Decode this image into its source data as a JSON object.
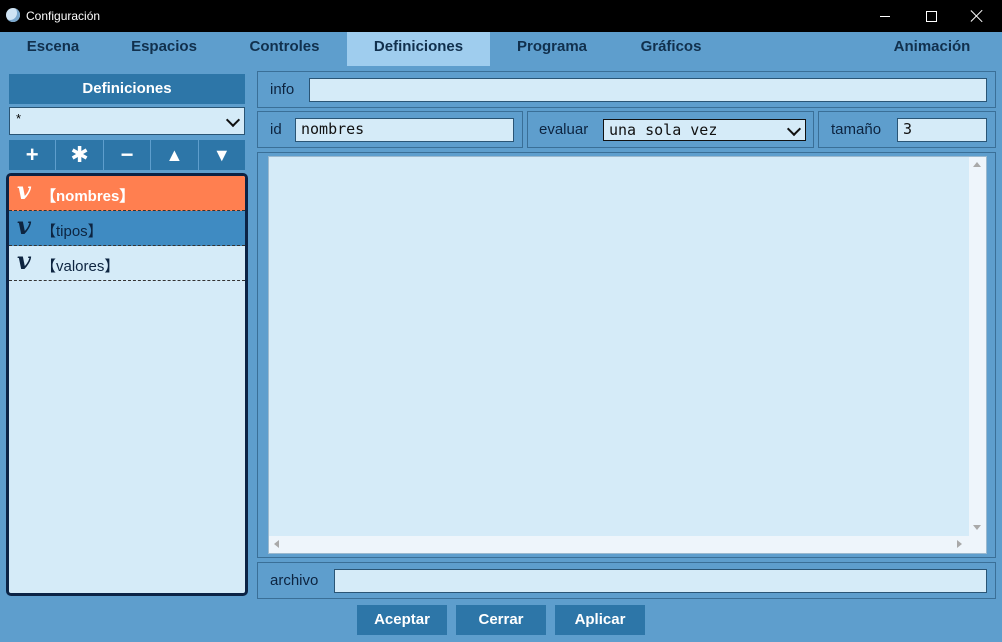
{
  "window": {
    "title": "Configuración"
  },
  "tabs": [
    {
      "label": "Escena"
    },
    {
      "label": "Espacios"
    },
    {
      "label": "Controles"
    },
    {
      "label": "Definiciones",
      "active": true
    },
    {
      "label": "Programa"
    },
    {
      "label": "Gráficos"
    },
    {
      "label": "Animación"
    }
  ],
  "sidebar": {
    "header": "Definiciones",
    "filter_value": "*",
    "toolbar": {
      "add": "+",
      "duplicate": "✱",
      "remove": "−",
      "up": "▲",
      "down": "▼"
    },
    "items": [
      {
        "symbol": "v",
        "label": "【nombres】",
        "selected": true
      },
      {
        "symbol": "v",
        "label": "【tipos】"
      },
      {
        "symbol": "v",
        "label": "【valores】"
      }
    ]
  },
  "form": {
    "info_label": "info",
    "info_value": "",
    "id_label": "id",
    "id_value": "nombres",
    "evaluar_label": "evaluar",
    "evaluar_value": "una sola vez",
    "tamano_label": "tamaño",
    "tamano_value": "3",
    "editor_content": "",
    "archivo_label": "archivo",
    "archivo_value": ""
  },
  "buttons": {
    "aceptar": "Aceptar",
    "cerrar": "Cerrar",
    "aplicar": "Aplicar"
  },
  "colors": {
    "accent": "#2d76a8",
    "selected": "#ff7f50",
    "panel": "#5e9ecd",
    "field": "#d5ebf8"
  }
}
